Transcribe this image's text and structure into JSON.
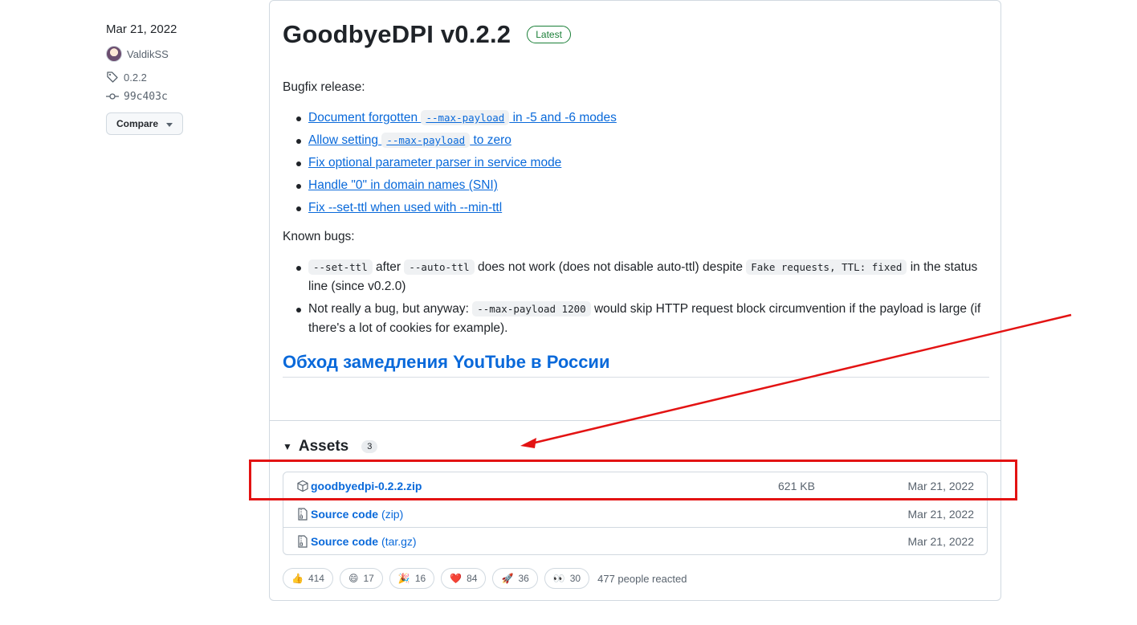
{
  "meta": {
    "date": "Mar 21, 2022",
    "author": "ValdikSS",
    "tag": "0.2.2",
    "commit": "99c403c",
    "compare_label": "Compare"
  },
  "release": {
    "title": "GoodbyeDPI v0.2.2",
    "badge": "Latest",
    "intro": "Bugfix release:",
    "bugfixes": [
      {
        "pre": "Document forgotten ",
        "code": "--max-payload",
        "post": " in -5 and -6 modes"
      },
      {
        "pre": "Allow setting ",
        "code": "--max-payload",
        "post": " to zero"
      },
      {
        "text": "Fix optional parameter parser in service mode"
      },
      {
        "text": "Handle \"0\" in domain names (SNI)"
      },
      {
        "text": "Fix --set-ttl when used with --min-ttl"
      }
    ],
    "known_bugs_title": "Known bugs:",
    "known_bugs": [
      {
        "code1": "--set-ttl",
        "t1": " after ",
        "code2": "--auto-ttl",
        "t2": " does not work (does not disable auto-ttl) despite ",
        "code3": "Fake requests, TTL: fixed",
        "t3": " in the status line (since v0.2.0)"
      },
      {
        "t1": "Not really a bug, but anyway: ",
        "code1": "--max-payload 1200",
        "t2": " would skip HTTP request block circumvention if the payload is large (if there's a lot of cookies for example)."
      }
    ],
    "russian_heading": "Обход замедления YouTube в России"
  },
  "assets": {
    "title": "Assets",
    "count": "3",
    "items": [
      {
        "name": "goodbyedpi-0.2.2.zip",
        "sub": "",
        "size": "621 KB",
        "date": "Mar 21, 2022",
        "icon": "package-icon"
      },
      {
        "name": "Source code",
        "sub": "(zip)",
        "size": "",
        "date": "Mar 21, 2022",
        "icon": "file-zip-icon"
      },
      {
        "name": "Source code",
        "sub": "(tar.gz)",
        "size": "",
        "date": "Mar 21, 2022",
        "icon": "file-zip-icon"
      }
    ]
  },
  "reactions": {
    "items": [
      {
        "emoji": "👍",
        "count": "414"
      },
      {
        "emoji": "😄",
        "count": "17"
      },
      {
        "emoji": "🎉",
        "count": "16"
      },
      {
        "emoji": "❤️",
        "count": "84"
      },
      {
        "emoji": "🚀",
        "count": "36"
      },
      {
        "emoji": "👀",
        "count": "30"
      }
    ],
    "summary": "477 people reacted"
  },
  "colors": {
    "accent_link": "#0969da",
    "latest_badge": "#1a7f37",
    "annotation_red": "#e31313"
  }
}
